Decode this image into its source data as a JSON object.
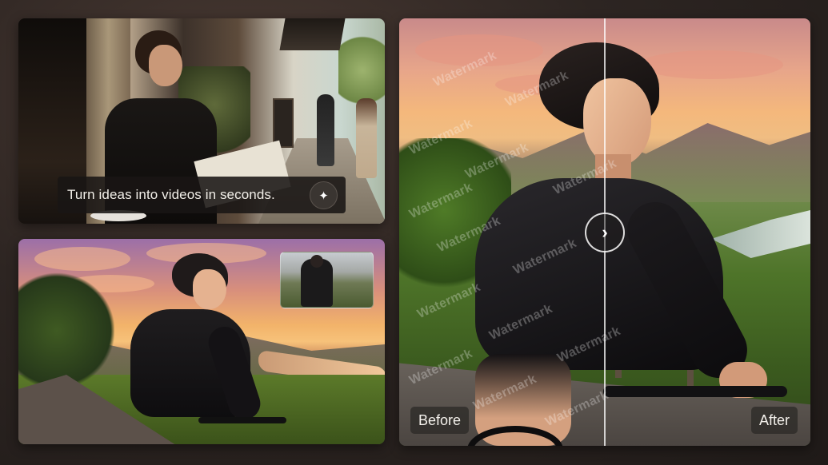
{
  "cafe_card": {
    "caption": "Turn ideas into videos in seconds.",
    "action_icon": "sparkle-icon"
  },
  "anime_card": {
    "thumbnail_label": ""
  },
  "compare_card": {
    "before_label": "Before",
    "after_label": "After",
    "handle_icon": "chevron-right-icon",
    "watermark_text": "Watermark",
    "slider_position": 0.5
  },
  "colors": {
    "background": "#2d2522",
    "caption_bg": "#191614",
    "divider": "#ffffff"
  }
}
